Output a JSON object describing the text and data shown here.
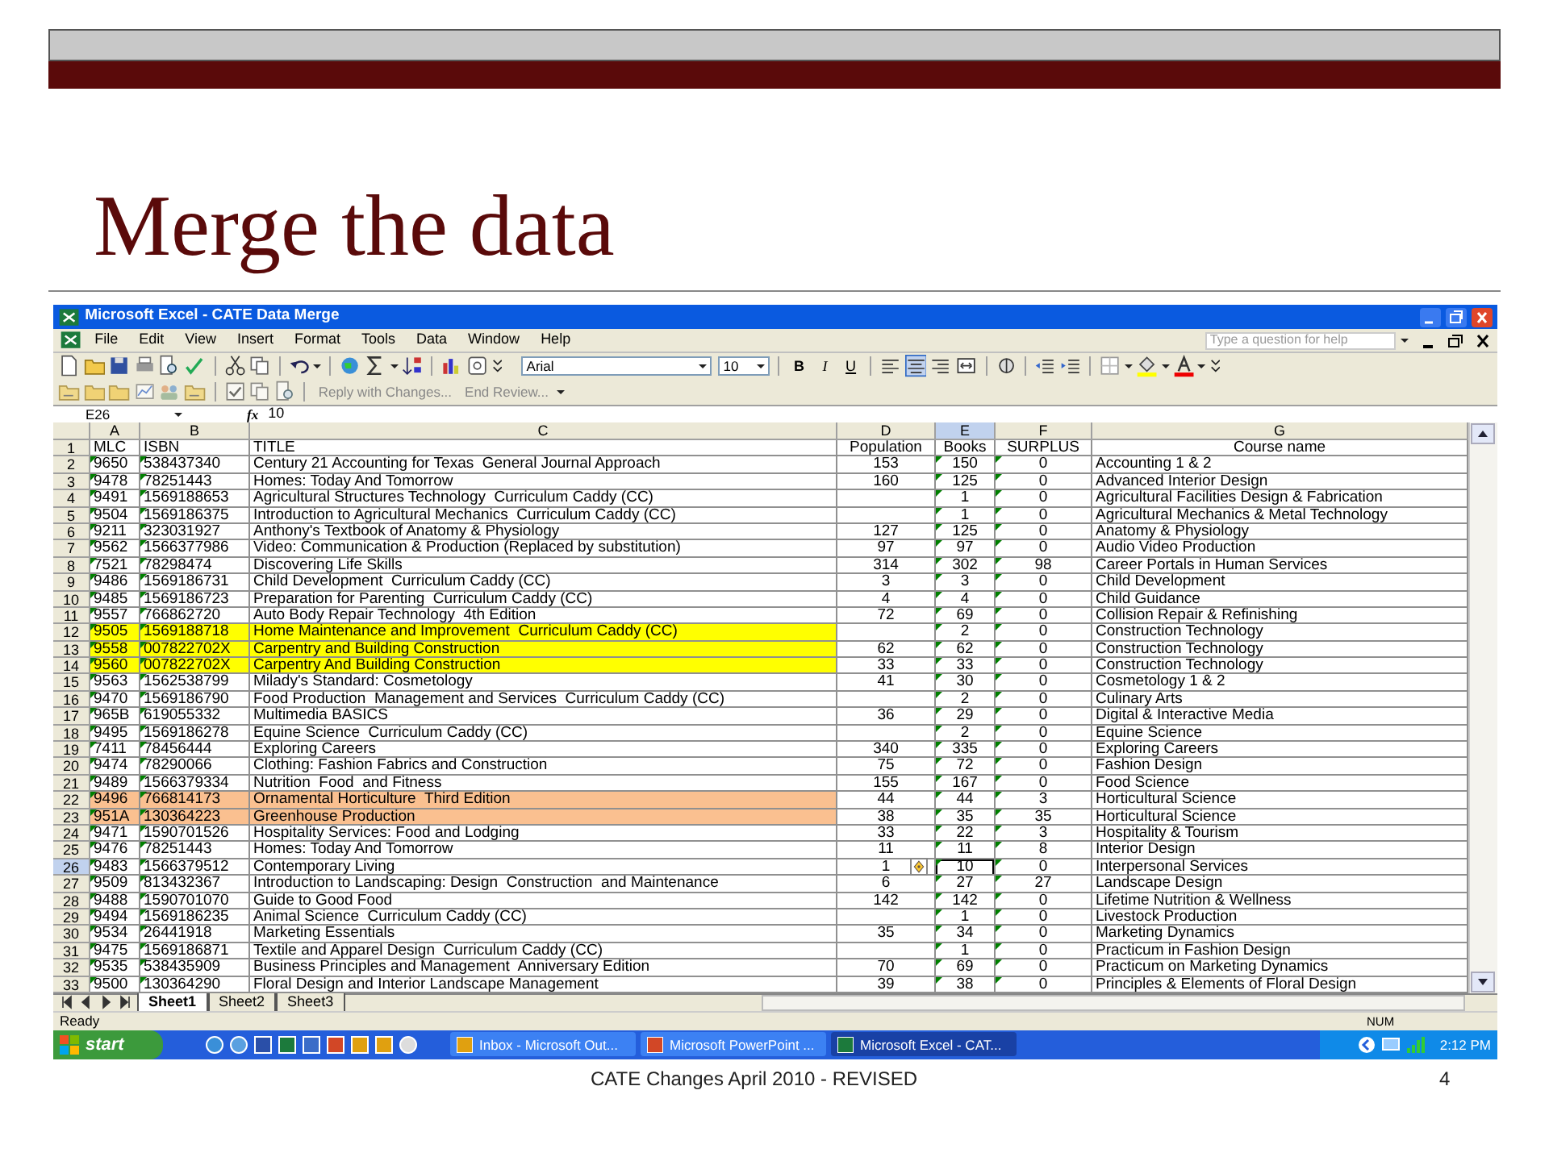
{
  "slide": {
    "title": "Merge the data",
    "footer": "CATE Changes April 2010 - REVISED",
    "page_number": "4"
  },
  "excel": {
    "window_title": "Microsoft Excel - CATE Data Merge",
    "menu": [
      "File",
      "Edit",
      "View",
      "Insert",
      "Format",
      "Tools",
      "Data",
      "Window",
      "Help"
    ],
    "help_placeholder": "Type a question for help",
    "font": "Arial",
    "font_size": "10",
    "format_buttons": [
      "B",
      "I",
      "U"
    ],
    "review_buttons": [
      "Reply with Changes...",
      "End Review..."
    ],
    "name_box": "E26",
    "formula_label": "fx",
    "formula": "10",
    "columns": [
      {
        "label": "A",
        "selected": false
      },
      {
        "label": "B",
        "selected": false
      },
      {
        "label": "C",
        "selected": false
      },
      {
        "label": "D",
        "selected": false
      },
      {
        "label": "E",
        "selected": true
      },
      {
        "label": "F",
        "selected": false
      },
      {
        "label": "G",
        "selected": false
      }
    ],
    "rows": [
      {
        "number": "1",
        "selected": false,
        "cells": [
          "MLC",
          "ISBN",
          "TITLE",
          "Population",
          "Books",
          "SURPLUS",
          "Course name"
        ]
      },
      {
        "number": "2",
        "selected": false,
        "cells": [
          "9650",
          "538437340",
          "Century 21 Accounting for Texas  General Journal Approach",
          "153",
          "150",
          "0",
          "Accounting 1 & 2"
        ]
      },
      {
        "number": "3",
        "selected": false,
        "cells": [
          "9478",
          "78251443",
          "Homes: Today And Tomorrow",
          "160",
          "125",
          "0",
          "Advanced Interior Design"
        ]
      },
      {
        "number": "4",
        "selected": false,
        "cells": [
          "9491",
          "1569188653",
          "Agricultural Structures Technology  Curriculum Caddy (CC)",
          null,
          "1",
          "0",
          "Agricultural Facilities Design & Fabrication"
        ]
      },
      {
        "number": "5",
        "selected": false,
        "cells": [
          "9504",
          "1569186375",
          "Introduction to Agricultural Mechanics  Curriculum Caddy (CC)",
          null,
          "1",
          "0",
          "Agricultural Mechanics & Metal Technology"
        ]
      },
      {
        "number": "6",
        "selected": false,
        "cells": [
          "9211",
          "323031927",
          "Anthony's Textbook of Anatomy & Physiology",
          "127",
          "125",
          "0",
          "Anatomy & Physiology"
        ]
      },
      {
        "number": "7",
        "selected": false,
        "cells": [
          "9562",
          "1566377986",
          "Video: Communication & Production (Replaced by substitution)",
          "97",
          "97",
          "0",
          "Audio Video Production"
        ]
      },
      {
        "number": "8",
        "selected": false,
        "cells": [
          "7521",
          "78298474",
          "Discovering Life Skills",
          "314",
          "302",
          "98",
          "Career Portals in Human Services"
        ]
      },
      {
        "number": "9",
        "selected": false,
        "cells": [
          "9486",
          "1569186731",
          "Child Development  Curriculum Caddy (CC)",
          "3",
          "3",
          "0",
          "Child Development"
        ]
      },
      {
        "number": "10",
        "selected": false,
        "cells": [
          "9485",
          "1569186723",
          "Preparation for Parenting  Curriculum Caddy (CC)",
          "4",
          "4",
          "0",
          "Child Guidance"
        ]
      },
      {
        "number": "11",
        "selected": false,
        "cells": [
          "9557",
          "766862720",
          "Auto Body Repair Technology  4th Edition",
          "72",
          "69",
          "0",
          "Collision Repair & Refinishing"
        ]
      },
      {
        "number": "12",
        "selected": false,
        "color": "#ffff00",
        "cells": [
          "9505",
          "1569188718",
          "Home Maintenance and Improvement  Curriculum Caddy (CC)",
          null,
          "2",
          "0",
          "Construction Technology"
        ]
      },
      {
        "number": "13",
        "selected": false,
        "color": "#ffff00",
        "cells": [
          "9558",
          "007822702X",
          "Carpentry and Building Construction",
          "62",
          "62",
          "0",
          "Construction Technology"
        ]
      },
      {
        "number": "14",
        "selected": false,
        "color": "#ffff00",
        "cells": [
          "9560",
          "007822702X",
          "Carpentry And Building Construction",
          "33",
          "33",
          "0",
          "Construction Technology"
        ]
      },
      {
        "number": "15",
        "selected": false,
        "cells": [
          "9563",
          "1562538799",
          "Milady's Standard: Cosmetology",
          "41",
          "30",
          "0",
          "Cosmetology 1 & 2"
        ]
      },
      {
        "number": "16",
        "selected": false,
        "cells": [
          "9470",
          "1569186790",
          "Food Production  Management and Services  Curriculum Caddy (CC)",
          null,
          "2",
          "0",
          "Culinary Arts"
        ]
      },
      {
        "number": "17",
        "selected": false,
        "cells": [
          "965B",
          "619055332",
          "Multimedia BASICS",
          "36",
          "29",
          "0",
          "Digital & Interactive Media"
        ]
      },
      {
        "number": "18",
        "selected": false,
        "cells": [
          "9495",
          "1569186278",
          "Equine Science  Curriculum Caddy (CC)",
          null,
          "2",
          "0",
          "Equine Science"
        ]
      },
      {
        "number": "19",
        "selected": false,
        "cells": [
          "7411",
          "78456444",
          "Exploring Careers",
          "340",
          "335",
          "0",
          "Exploring Careers"
        ]
      },
      {
        "number": "20",
        "selected": false,
        "cells": [
          "9474",
          "78290066",
          "Clothing: Fashion Fabrics and Construction",
          "75",
          "72",
          "0",
          "Fashion Design"
        ]
      },
      {
        "number": "21",
        "selected": false,
        "cells": [
          "9489",
          "1566379334",
          "Nutrition  Food  and Fitness",
          "155",
          "167",
          "0",
          "Food Science"
        ]
      },
      {
        "number": "22",
        "selected": false,
        "color": "#fac090",
        "cells": [
          "9496",
          "766814173",
          "Ornamental Horticulture  Third Edition",
          "44",
          "44",
          "3",
          "Horticultural Science"
        ]
      },
      {
        "number": "23",
        "selected": false,
        "color": "#fac090",
        "cells": [
          "951A",
          "130364223",
          "Greenhouse Production",
          "38",
          "35",
          "35",
          "Horticultural Science"
        ]
      },
      {
        "number": "24",
        "selected": false,
        "cells": [
          "9471",
          "1590701526",
          "Hospitality Services: Food and Lodging",
          "33",
          "22",
          "3",
          "Hospitality & Tourism"
        ]
      },
      {
        "number": "25",
        "selected": false,
        "cells": [
          "9476",
          "78251443",
          "Homes: Today And Tomorrow",
          "11",
          "11",
          "8",
          "Interior Design"
        ]
      },
      {
        "number": "26",
        "selected": true,
        "cells": [
          "9483",
          "1566379512",
          "Contemporary Living",
          "1",
          "10",
          "0",
          "Interpersonal Services"
        ]
      },
      {
        "number": "27",
        "selected": false,
        "cells": [
          "9509",
          "813432367",
          "Introduction to Landscaping: Design  Construction  and Maintenance",
          "6",
          "27",
          "27",
          "Landscape Design"
        ]
      },
      {
        "number": "28",
        "selected": false,
        "cells": [
          "9488",
          "1590701070",
          "Guide to Good Food",
          "142",
          "142",
          "0",
          "Lifetime Nutrition & Wellness"
        ]
      },
      {
        "number": "29",
        "selected": false,
        "cells": [
          "9494",
          "1569186235",
          "Animal Science  Curriculum Caddy (CC)",
          null,
          "1",
          "0",
          "Livestock Production"
        ]
      },
      {
        "number": "30",
        "selected": false,
        "cells": [
          "9534",
          "26441918",
          "Marketing Essentials",
          "35",
          "34",
          "0",
          "Marketing Dynamics"
        ]
      },
      {
        "number": "31",
        "selected": false,
        "cells": [
          "9475",
          "1569186871",
          "Textile and Apparel Design  Curriculum Caddy (CC)",
          null,
          "1",
          "0",
          "Practicum in Fashion Design"
        ]
      },
      {
        "number": "32",
        "selected": false,
        "cells": [
          "9535",
          "538435909",
          "Business Principles and Management  Anniversary Edition",
          "70",
          "69",
          "0",
          "Practicum on Marketing Dynamics"
        ]
      },
      {
        "number": "33",
        "selected": false,
        "cells": [
          "9500",
          "130364290",
          "Floral Design and Interior Landscape Management",
          "39",
          "38",
          "0",
          "Principles & Elements of Floral Design"
        ]
      }
    ],
    "sheet_tabs": [
      {
        "label": "Sheet1",
        "selected": true
      },
      {
        "label": "Sheet2",
        "selected": false
      },
      {
        "label": "Sheet3",
        "selected": false
      }
    ],
    "status": "Ready",
    "indicator": "NUM"
  },
  "taskbar": {
    "start": "start",
    "tasks": [
      {
        "label": "Inbox - Microsoft Out...",
        "selected": false
      },
      {
        "label": "Microsoft PowerPoint ...",
        "selected": false
      },
      {
        "label": "Microsoft Excel - CAT...",
        "selected": true
      }
    ],
    "clock": "2:12 PM"
  }
}
